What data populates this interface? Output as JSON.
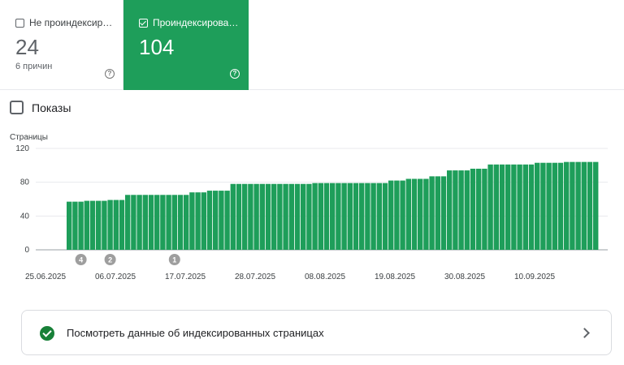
{
  "cards": {
    "not_indexed": {
      "label": "Не проиндексир…",
      "value": "24",
      "sub": "6 причин",
      "help": "?"
    },
    "indexed": {
      "label": "Проиндексирова…",
      "value": "104",
      "help": "?"
    }
  },
  "impressions": {
    "label": "Показы"
  },
  "chart_data": {
    "type": "bar",
    "ylabel": "Страницы",
    "ylim": [
      0,
      120
    ],
    "yticks": [
      "120",
      "80",
      "40",
      "0"
    ],
    "xtick_labels": [
      "25.06.2025",
      "06.07.2025",
      "17.07.2025",
      "28.07.2025",
      "08.08.2025",
      "19.08.2025",
      "30.08.2025",
      "10.09.2025"
    ],
    "color": "#1e9e5a",
    "values": [
      57,
      57,
      57,
      58,
      58,
      58,
      58,
      59,
      59,
      59,
      65,
      65,
      65,
      65,
      65,
      65,
      65,
      65,
      65,
      65,
      65,
      68,
      68,
      68,
      70,
      70,
      70,
      70,
      78,
      78,
      78,
      78,
      78,
      78,
      78,
      78,
      78,
      78,
      78,
      78,
      78,
      78,
      79,
      79,
      79,
      79,
      79,
      79,
      79,
      79,
      79,
      79,
      79,
      79,
      79,
      82,
      82,
      82,
      84,
      84,
      84,
      84,
      87,
      87,
      87,
      94,
      94,
      94,
      94,
      96,
      96,
      96,
      101,
      101,
      101,
      101,
      101,
      101,
      101,
      101,
      103,
      103,
      103,
      103,
      103,
      104,
      104,
      104,
      104,
      104,
      104
    ],
    "annotations": [
      {
        "label": "4",
        "bar_index": 2
      },
      {
        "label": "2",
        "bar_index": 7
      },
      {
        "label": "1",
        "bar_index": 18
      }
    ]
  },
  "link": {
    "label": "Посмотреть данные об индексированных страницах"
  }
}
